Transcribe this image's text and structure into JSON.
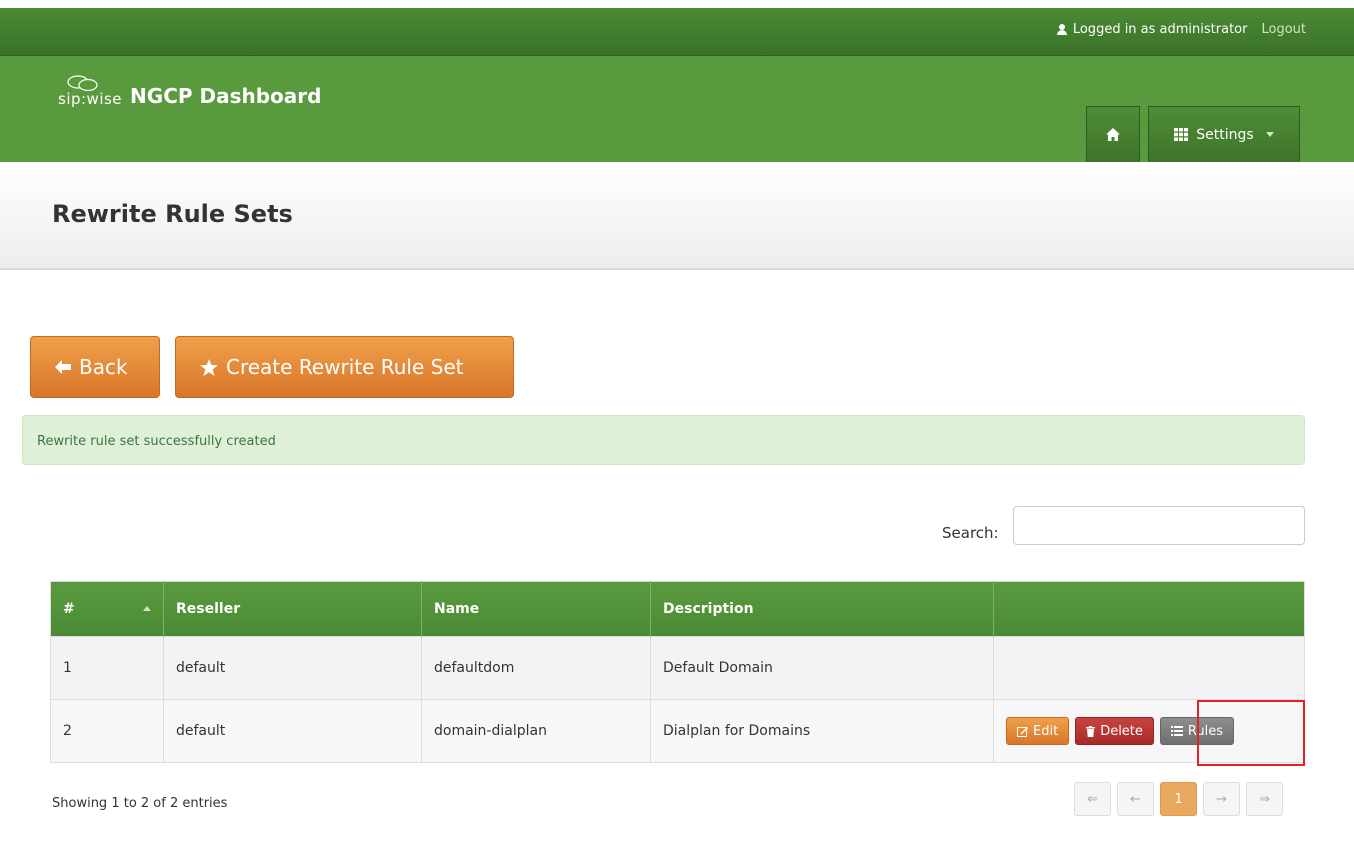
{
  "topbar": {
    "user_label": "Logged in as administrator",
    "logout_label": "Logout"
  },
  "brand": {
    "logo_text": "sip:wise",
    "title": "NGCP Dashboard"
  },
  "nav": {
    "settings_label": "Settings"
  },
  "page": {
    "title": "Rewrite Rule Sets"
  },
  "actions": {
    "back_label": "Back",
    "create_label": "Create Rewrite Rule Set"
  },
  "alert": {
    "message": "Rewrite rule set successfully created"
  },
  "search": {
    "label": "Search:",
    "value": ""
  },
  "table": {
    "columns": [
      "#",
      "Reseller",
      "Name",
      "Description",
      ""
    ],
    "rows": [
      {
        "id": "1",
        "reseller": "default",
        "name": "defaultdom",
        "description": "Default Domain"
      },
      {
        "id": "2",
        "reseller": "default",
        "name": "domain-dialplan",
        "description": "Dialplan for Domains"
      }
    ],
    "row_actions": {
      "edit_label": "Edit",
      "delete_label": "Delete",
      "rules_label": "Rules"
    }
  },
  "pagination": {
    "info": "Showing 1 to 2 of 2 entries",
    "first": "⇐",
    "prev": "←",
    "current": "1",
    "next": "→",
    "last": "⇒"
  },
  "colors": {
    "header_green": "#5a9a3e",
    "accent_orange": "#e0893a",
    "danger_red": "#b5322f",
    "highlight_red": "#e8201f"
  }
}
